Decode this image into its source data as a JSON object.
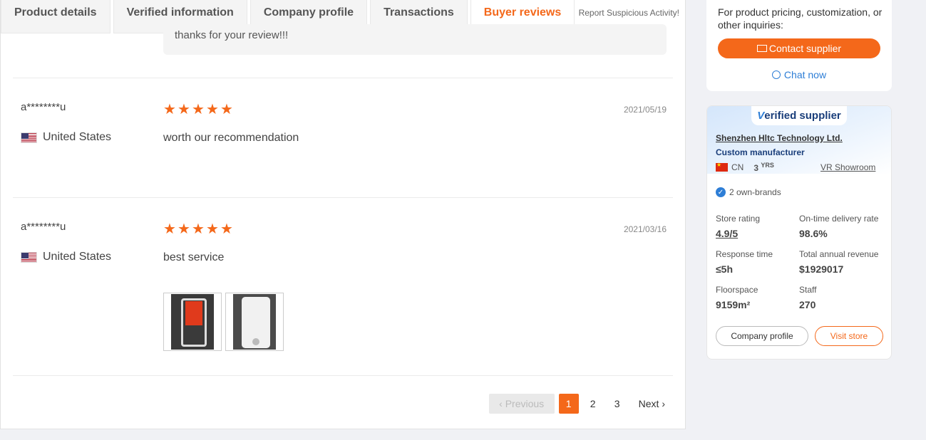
{
  "tabs": [
    {
      "label": "Product details",
      "active": false
    },
    {
      "label": "Verified information",
      "active": false
    },
    {
      "label": "Company profile",
      "active": false
    },
    {
      "label": "Transactions",
      "active": false
    },
    {
      "label": "Buyer reviews",
      "active": true
    }
  ],
  "report_link": "Report Suspicious Activity!",
  "reply_text": "thanks for your review!!!",
  "reviews": [
    {
      "reviewer": "a********u",
      "country": "United States",
      "rating": 5,
      "date": "2021/05/19",
      "comment": "worth our recommendation",
      "has_images": false
    },
    {
      "reviewer": "a********u",
      "country": "United States",
      "rating": 5,
      "date": "2021/03/16",
      "comment": "best service",
      "has_images": true
    }
  ],
  "pagination": {
    "prev_label": "Previous",
    "pages": [
      "1",
      "2",
      "3"
    ],
    "current": "1",
    "next_label": "Next"
  },
  "inquiry": {
    "text": "For product pricing, customization, or other inquiries:",
    "contact_label": "Contact supplier",
    "chat_label": "Chat now"
  },
  "supplier": {
    "badge_v": "V",
    "badge_rest": "erified supplier",
    "name": "Shenzhen Hltc Technology Ltd.",
    "type": "Custom manufacturer",
    "country_code": "CN",
    "years": "3",
    "years_unit": "YRS",
    "vr_label": "VR Showroom",
    "brands": "2 own-brands",
    "stats": {
      "store_rating_label": "Store rating",
      "store_rating": "4.9/5",
      "delivery_label": "On-time delivery rate",
      "delivery": "98.6%",
      "response_label": "Response time",
      "response": "≤5h",
      "revenue_label": "Total annual revenue",
      "revenue": "$1929017",
      "floor_label": "Floorspace",
      "floor": "9159m²",
      "staff_label": "Staff",
      "staff": "270"
    },
    "company_profile_label": "Company profile",
    "visit_store_label": "Visit store"
  },
  "colors": {
    "accent": "#f4681a",
    "link_blue": "#2e7ed6"
  }
}
